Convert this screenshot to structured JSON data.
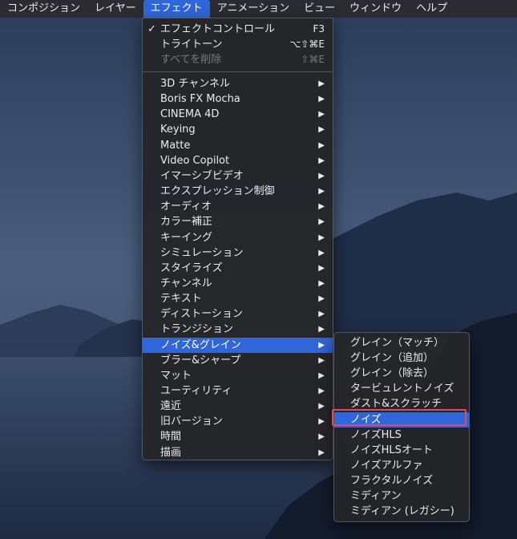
{
  "menubar": {
    "items": [
      "コンポジション",
      "レイヤー",
      "エフェクト",
      "アニメーション",
      "ビュー",
      "ウィンドウ",
      "ヘルプ"
    ],
    "active_index": 2
  },
  "effects_menu": {
    "top_items": [
      {
        "label": "エフェクトコントロール",
        "shortcut": "F3",
        "checked": true,
        "enabled": true
      },
      {
        "label": "トライトーン",
        "shortcut": "⌥⇧⌘E",
        "checked": false,
        "enabled": true
      },
      {
        "label": "すべてを削除",
        "shortcut": "⇧⌘E",
        "checked": false,
        "enabled": false
      }
    ],
    "check_glyph": "✓",
    "submenu_arrow": "▶",
    "categories": [
      "3D チャンネル",
      "Boris FX Mocha",
      "CINEMA 4D",
      "Keying",
      "Matte",
      "Video Copilot",
      "イマーシブビデオ",
      "エクスプレッション制御",
      "オーディオ",
      "カラー補正",
      "キーイング",
      "シミュレーション",
      "スタイライズ",
      "チャンネル",
      "テキスト",
      "ディストーション",
      "トランジション",
      "ノイズ&グレイン",
      "ブラー&シャープ",
      "マット",
      "ユーティリティ",
      "遠近",
      "旧バージョン",
      "時間",
      "描画"
    ],
    "highlighted_category": "ノイズ&グレイン"
  },
  "noise_submenu": {
    "items": [
      "グレイン（マッチ）",
      "グレイン（追加）",
      "グレイン（除去）",
      "タービュレントノイズ",
      "ダスト&スクラッチ",
      "ノイズ",
      "ノイズHLS",
      "ノイズHLSオート",
      "ノイズアルファ",
      "フラクタルノイズ",
      "ミディアン",
      "ミディアン (レガシー)"
    ],
    "highlighted_item": "ノイズ"
  },
  "colors": {
    "highlight": "#2f66d9",
    "outline": "#e34a5a",
    "menu_bg": "#242528"
  }
}
